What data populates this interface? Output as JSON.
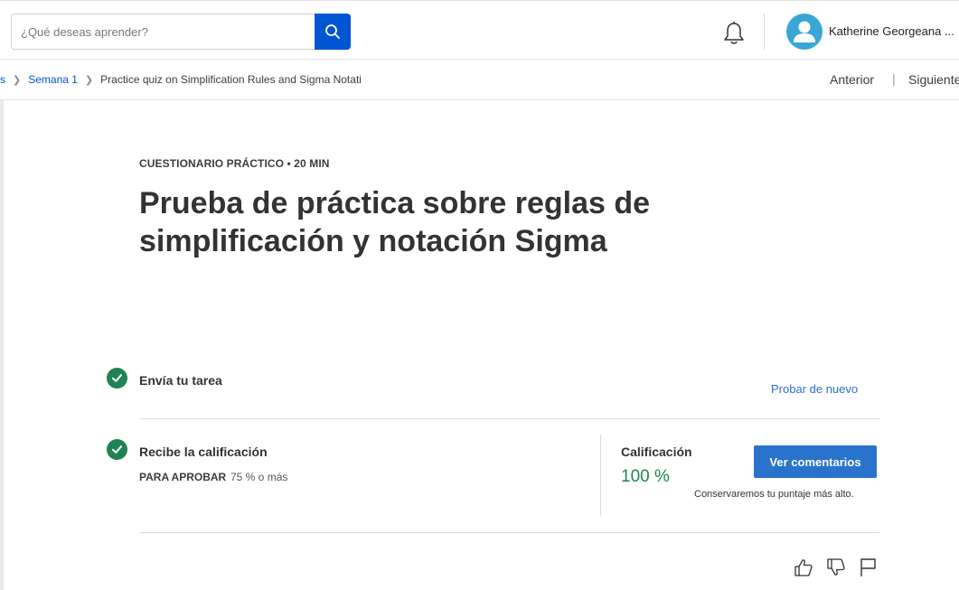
{
  "header": {
    "search": {
      "placeholder": "¿Qué deseas aprender?",
      "value": ""
    },
    "user_name": "Katherine Georgeana ..."
  },
  "breadcrumb": {
    "items": [
      "s",
      "Semana 1"
    ],
    "current": "Practice quiz on Simplification Rules and Sigma Notati"
  },
  "nav": {
    "prev": "Anterior",
    "separator": "|",
    "next": "Siguiente"
  },
  "main": {
    "eyebrow": "CUESTIONARIO PRÁCTICO • 20 MIN",
    "title": "Prueba de práctica sobre reglas de simplificación y notación Sigma",
    "step1": {
      "title": "Envía tu tarea",
      "action": "Probar de nuevo"
    },
    "step2": {
      "title": "Recibe la calificación",
      "pass_label": "PARA APROBAR",
      "pass_value": "75 % o más"
    },
    "grade": {
      "label": "Calificación",
      "value": "100 %",
      "button": "Ver comentarios",
      "note": "Conservaremos tu puntaje más alto."
    }
  },
  "icons": [
    "search-icon",
    "bell-icon",
    "avatar-person-icon",
    "chevron-right-icon",
    "check-icon",
    "thumbs-up-icon",
    "thumbs-down-icon",
    "flag-icon"
  ],
  "colors": {
    "primary": "#0056d2",
    "button": "#2a73cc",
    "success": "#1f8354",
    "avatar": "#3aa6d8"
  }
}
